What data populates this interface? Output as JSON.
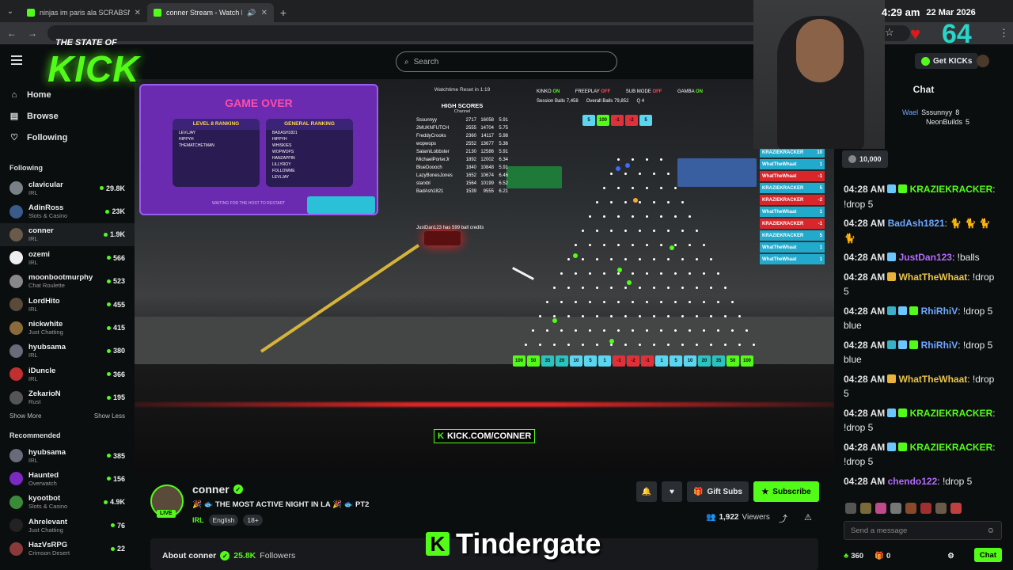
{
  "browser": {
    "tabs": [
      {
        "title": "ninjas im paris ala SCRABSNYC",
        "active": false
      },
      {
        "title": "conner Stream - Watch Live",
        "active": true
      }
    ],
    "new_tab": "+",
    "time": "4:29 am",
    "date": "22 Mar 2026",
    "overlay_number": "64"
  },
  "header": {
    "search_placeholder": "Search",
    "get_kicks": "Get KICKs"
  },
  "logo_overlay": {
    "line1": "THE STATE OF",
    "line2": "KICK"
  },
  "sidebar": {
    "nav": [
      {
        "label": "Home",
        "icon": "home-icon"
      },
      {
        "label": "Browse",
        "icon": "browse-icon"
      },
      {
        "label": "Following",
        "icon": "heart-icon"
      }
    ],
    "following_title": "Following",
    "following": [
      {
        "name": "clavicular",
        "category": "IRL",
        "viewers": "29.8K",
        "color": "#7a8088"
      },
      {
        "name": "AdinRoss",
        "category": "Slots & Casino",
        "viewers": "23K",
        "color": "#3a5a8a"
      },
      {
        "name": "conner",
        "category": "IRL",
        "viewers": "1.9K",
        "color": "#6a5a4a"
      },
      {
        "name": "ozemi",
        "category": "IRL",
        "viewers": "566",
        "color": "#eeeeee"
      },
      {
        "name": "moonbootmurphy",
        "category": "Chat Roulette",
        "viewers": "523",
        "color": "#888888"
      },
      {
        "name": "LordHito",
        "category": "IRL",
        "viewers": "455",
        "color": "#5a4a3a"
      },
      {
        "name": "nickwhite",
        "category": "Just Chatting",
        "viewers": "415",
        "color": "#8a6a3a"
      },
      {
        "name": "hyubsama",
        "category": "IRL",
        "viewers": "380",
        "color": "#6a6a7a"
      },
      {
        "name": "iDuncle",
        "category": "IRL",
        "viewers": "366",
        "color": "#c03030"
      },
      {
        "name": "ZekarioN",
        "category": "Rust",
        "viewers": "195",
        "color": "#555555"
      }
    ],
    "show_more": "Show More",
    "show_less": "Show Less",
    "recommended_title": "Recommended",
    "recommended": [
      {
        "name": "hyubsama",
        "category": "IRL",
        "viewers": "385",
        "color": "#6a6a7a"
      },
      {
        "name": "Haunted",
        "category": "Overwatch",
        "viewers": "156",
        "color": "#7a2ac0"
      },
      {
        "name": "kyootbot",
        "category": "Slots & Casino",
        "viewers": "4.9K",
        "color": "#3a8a3a"
      },
      {
        "name": "Ahrelevant",
        "category": "Just Chatting",
        "viewers": "76",
        "color": "#222222"
      },
      {
        "name": "HazVsRPG",
        "category": "Crimson Desert",
        "viewers": "22",
        "color": "#8a3a3a"
      }
    ]
  },
  "video": {
    "game_over": {
      "title": "GAME OVER",
      "level_label": "LEVEL 8",
      "level_sub": "RANKING",
      "general_label": "GENERAL",
      "general_sub": "RANKING",
      "level_rows": [
        "LEVLJAY",
        "HIPPYH",
        "THEMATCHETMAN"
      ],
      "general_rows": [
        "BADASH1821",
        "HIPPYH",
        "WHISKIES",
        "WOPWOPS",
        "HANZAPPIN",
        "LILLYROY",
        "FOLLOWME",
        "LEVLJAY"
      ],
      "waiting": "WAITING FOR THE HOST TO RESTART"
    },
    "high_scores": {
      "reset": "Watchtime Reset in 1:19",
      "title": "HIGH SCORES",
      "sub": "Channel",
      "rows": [
        [
          "Sssunnyy",
          "2717",
          "16058",
          "5.91"
        ],
        [
          "2MUKNFUTCH",
          "2555",
          "14704",
          "5.75"
        ],
        [
          "FreddyCrooks",
          "2360",
          "14117",
          "5.98"
        ],
        [
          "wopwops",
          "2552",
          "13677",
          "5.36"
        ],
        [
          "SalamiLobbster",
          "2130",
          "12586",
          "5.91"
        ],
        [
          "MichaelPorterJr",
          "1892",
          "12002",
          "6.34"
        ],
        [
          "BlueDoooch",
          "1840",
          "10848",
          "5.91"
        ],
        [
          "LazyBonesJones",
          "1652",
          "10674",
          "6.46"
        ],
        [
          "starxbl",
          "1564",
          "10199",
          "6.52"
        ],
        [
          "BadAsh1821",
          "1539",
          "9555",
          "6.21"
        ]
      ],
      "credits": "JustDan123 has 599 ball credits"
    },
    "stats": {
      "kinko": "KINKO",
      "kinko_state": "ON",
      "freeplay": "FREEPLAY",
      "freeplay_state": "OFF",
      "submode": "SUB MODE",
      "submode_state": "OFF",
      "gamba": "GAMBA",
      "gamba_state": "ON",
      "session_label": "Session Balls",
      "session_val": "7,458",
      "overall_label": "Overall Balls",
      "overall_val": "79,852",
      "q_label": "Q",
      "q_val": "4"
    },
    "top_slots": [
      "5",
      "100",
      "-1",
      "-2",
      "5"
    ],
    "bottom_slots": [
      "100",
      "50",
      "35",
      "20",
      "10",
      "5",
      "1",
      "-1",
      "-2",
      "-1",
      "1",
      "5",
      "10",
      "20",
      "35",
      "50",
      "100"
    ],
    "events": [
      {
        "name": "KRAZIEKRACKER",
        "val": "10",
        "color": "#22aacc"
      },
      {
        "name": "WhatTheWhaat",
        "val": "1",
        "color": "#22aacc"
      },
      {
        "name": "WhatTheWhaat",
        "val": "-1",
        "color": "#d8262a"
      },
      {
        "name": "KRAZIEKRACKER",
        "val": "5",
        "color": "#22aacc"
      },
      {
        "name": "KRAZIEKRACKER",
        "val": "-2",
        "color": "#d8262a"
      },
      {
        "name": "WhatTheWhaat",
        "val": "1",
        "color": "#22aacc"
      },
      {
        "name": "KRAZIEKRACKER",
        "val": "-1",
        "color": "#d8262a"
      },
      {
        "name": "KRAZIEKRACKER",
        "val": "5",
        "color": "#22aacc"
      },
      {
        "name": "WhatTheWhaat",
        "val": "1",
        "color": "#22aacc"
      },
      {
        "name": "WhatTheWhaat",
        "val": "1",
        "color": "#22aacc"
      }
    ],
    "watermark": "KICK.COM/CONNER"
  },
  "stream": {
    "name": "conner",
    "live": "LIVE",
    "title": "🎉 🐟 THE MOST ACTIVE NIGHT IN LA 🎉 🐟 PT2",
    "category": "IRL",
    "tags": [
      "English",
      "18+"
    ],
    "gift_subs": "Gift Subs",
    "subscribe": "Subscribe",
    "viewers": "1,922",
    "viewers_label": "Viewers",
    "about": "About conner",
    "followers": "25.8K",
    "followers_label": "Followers",
    "caption": "Tindergate"
  },
  "chat": {
    "title": "Chat",
    "top": [
      {
        "name": "Wael",
        "extra": "Sssunnyy",
        "count": "8"
      },
      {
        "name": "",
        "extra": "NeonBuilds",
        "count": "5"
      }
    ],
    "kicks_amount": "10,000",
    "messages": [
      {
        "time": "04:28 AM",
        "badges": [
          "#6ec6ff",
          "#53fc18"
        ],
        "user": "KRAZIEKRACKER",
        "color": "#53fc18",
        "text": ": !drop 5"
      },
      {
        "time": "04:28 AM",
        "badges": [],
        "user": "BadAsh1821",
        "color": "#6ea8ff",
        "text": ": 🐈 🐈 🐈 🐈"
      },
      {
        "time": "04:28 AM",
        "badges": [
          "#6ec6ff"
        ],
        "user": "JustDan123",
        "color": "#b36bff",
        "text": ": !balls"
      },
      {
        "time": "04:28 AM",
        "badges": [
          "#e8b33a"
        ],
        "user": "WhatTheWhaat",
        "color": "#e8c34a",
        "text": ": !drop 5"
      },
      {
        "time": "04:28 AM",
        "badges": [
          "#3ab0c8",
          "#6ec6ff",
          "#53fc18"
        ],
        "user": "RhiRhiV",
        "color": "#6ea8ff",
        "text": ": !drop 5 blue"
      },
      {
        "time": "04:28 AM",
        "badges": [
          "#3ab0c8",
          "#6ec6ff",
          "#53fc18"
        ],
        "user": "RhiRhiV",
        "color": "#6ea8ff",
        "text": ": !drop 5 blue"
      },
      {
        "time": "04:28 AM",
        "badges": [
          "#e8b33a"
        ],
        "user": "WhatTheWhaat",
        "color": "#e8c34a",
        "text": ": !drop 5"
      },
      {
        "time": "04:28 AM",
        "badges": [
          "#6ec6ff",
          "#53fc18"
        ],
        "user": "KRAZIEKRACKER",
        "color": "#53fc18",
        "text": ": !drop 5"
      },
      {
        "time": "04:28 AM",
        "badges": [
          "#6ec6ff",
          "#53fc18"
        ],
        "user": "KRAZIEKRACKER",
        "color": "#53fc18",
        "text": ": !drop 5"
      },
      {
        "time": "04:28 AM",
        "badges": [],
        "user": "chendo122",
        "color": "#b36bff",
        "text": ": !drop 5"
      }
    ],
    "input_placeholder": "Send a message",
    "points": "360",
    "gifts": "0",
    "send": "Chat"
  }
}
